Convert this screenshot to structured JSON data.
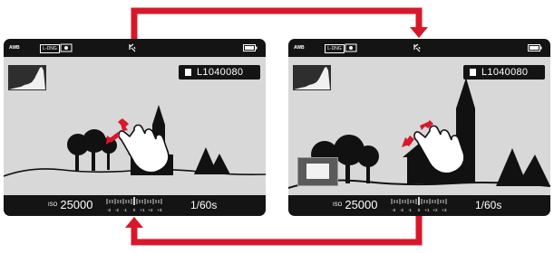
{
  "colors": {
    "arrow": "#d8182a",
    "screen_bg": "#d8d8d8",
    "bar_bg": "#141414",
    "silhouette": "#000000",
    "text": "#ffffff"
  },
  "screens": [
    {
      "label": "zoomed-out",
      "top_bar": {
        "awb": "AWB",
        "format": "L-DNG"
      },
      "file_info": {
        "filename": "L1040080"
      },
      "bottom_bar": {
        "iso_label": "ISO",
        "iso_value": "25000",
        "shutter": "1/60",
        "shutter_suffix": "s"
      },
      "gesture": "pinch-out",
      "icons": [
        "metering-icon",
        "stabilization-icon",
        "battery-icon",
        "sd-card-icon",
        "exposure-scale",
        "histogram",
        "hand-gesture-icon"
      ]
    },
    {
      "label": "zoomed-in",
      "top_bar": {
        "awb": "AWB",
        "format": "L-DNG"
      },
      "file_info": {
        "filename": "L1040080"
      },
      "bottom_bar": {
        "iso_label": "ISO",
        "iso_value": "25000",
        "shutter": "1/60",
        "shutter_suffix": "s"
      },
      "gesture": "pinch-in",
      "icons": [
        "metering-icon",
        "stabilization-icon",
        "battery-icon",
        "sd-card-icon",
        "exposure-scale",
        "histogram",
        "hand-gesture-icon",
        "navigation-box"
      ]
    }
  ],
  "exposure_scale": {
    "labels": [
      "-3",
      "-2",
      "-1",
      "0",
      "+1",
      "+2",
      "+3"
    ]
  },
  "flow": {
    "top_arrow": "screen1-to-screen2",
    "bottom_arrow": "screen2-to-screen1"
  }
}
